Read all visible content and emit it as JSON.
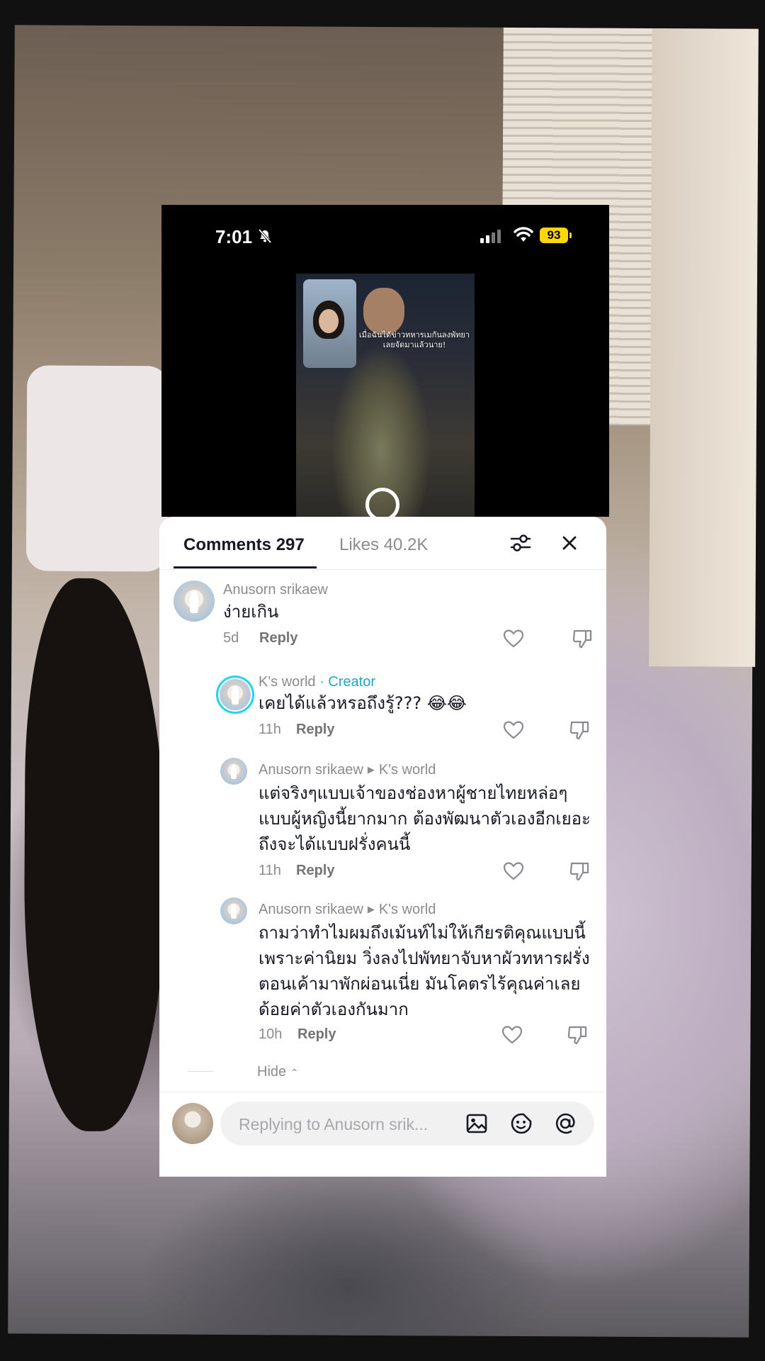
{
  "status_bar": {
    "time": "7:01",
    "battery": "93",
    "icons": [
      "bell-slash-icon",
      "signal-icon",
      "wifi-icon",
      "battery-icon"
    ]
  },
  "video": {
    "overlay_text": "เมื่อฉันได้ข่าวทหารเมกันลงพัทยาเลยจัดมาแล้วนาย!"
  },
  "sheet": {
    "tab_comments": "Comments 297",
    "tab_likes": "Likes 40.2K",
    "filter_icon": "sliders-icon",
    "close_icon": "close-icon"
  },
  "comments": [
    {
      "author": "Anusorn srikaew",
      "text": "ง่ายเกิน",
      "time": "5d",
      "reply_label": "Reply"
    },
    {
      "author": "K's world",
      "creator_label": "· Creator",
      "text": "เคยได้แล้วหรอถึงรู้??? 😂😂",
      "time": "11h",
      "reply_label": "Reply"
    },
    {
      "author": "Anusorn srikaew",
      "reply_to": "K's world",
      "text": "แต่จริงๆแบบเจ้าของช่องหาผู้ชายไทยหล่อๆแบบผู้หญิงนี้ยากมาก ต้องพัฒนาตัวเองอีกเยอะถึงจะได้แบบฝรั่งคนนี้",
      "time": "11h",
      "reply_label": "Reply"
    },
    {
      "author": "Anusorn srikaew",
      "reply_to": "K's world",
      "text": "ถามว่าทำไมผมถึงเม้นท์ไม่ให้เกียรติคุณแบบนี้ เพราะค่านิยม วิ่งลงไปพัทยาจับหาผัวทหารฝรั่งตอนเค้ามาพักผ่อนเนี่ย มันโคตรไร้คุณค่าเลย ด้อยค่าตัวเองกันมาก",
      "time": "10h",
      "reply_label": "Reply"
    }
  ],
  "hide_label": "Hide",
  "input": {
    "placeholder": "Replying to Anusorn srik..."
  },
  "colors": {
    "creator_accent": "#20a7c9",
    "battery": "#ffd60a",
    "sheet_bg": "#ffffff"
  }
}
